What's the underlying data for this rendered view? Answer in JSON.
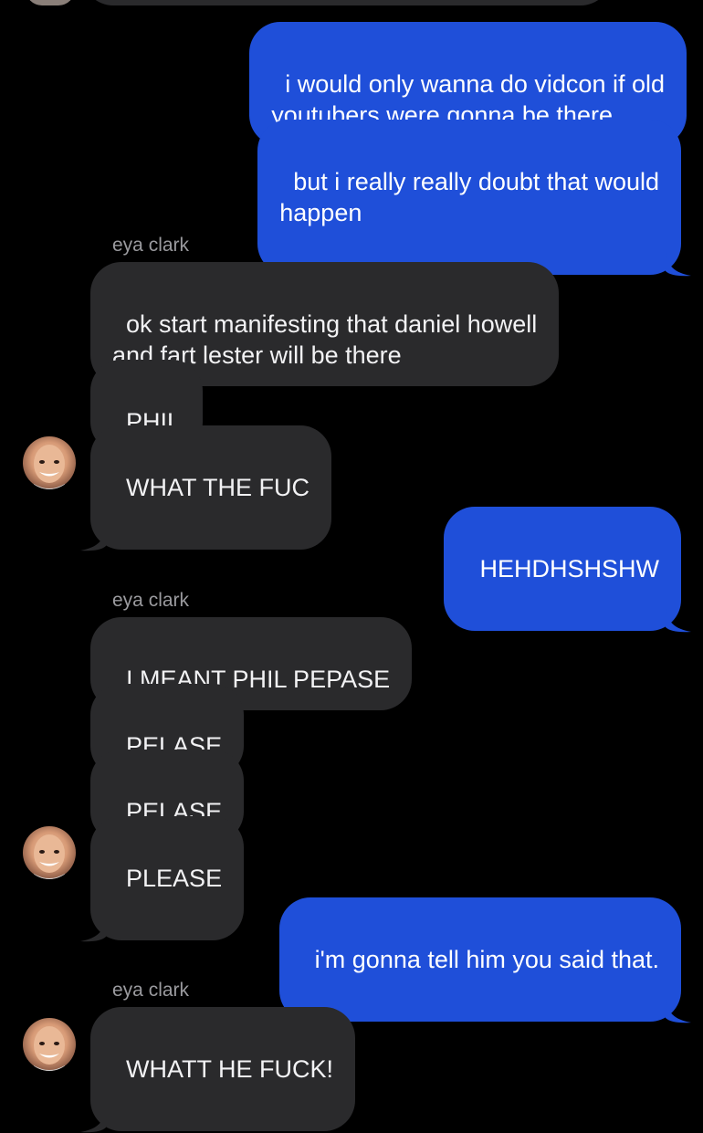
{
  "conversation": {
    "messages": [
      {
        "id": "m1",
        "direction": "out",
        "text": "i would only wanna do vidcon if old\nyoutubers were gonna be there"
      },
      {
        "id": "m2",
        "direction": "out",
        "text": "but i really really doubt that would\nhappen"
      },
      {
        "id": "s1",
        "type": "sender",
        "text": "eya clark"
      },
      {
        "id": "m3",
        "direction": "in",
        "text": "ok start manifesting that daniel howell\nand fart lester will be there"
      },
      {
        "id": "m4",
        "direction": "in",
        "text": "PHIL"
      },
      {
        "id": "m5",
        "direction": "in",
        "text": "WHAT THE FUC"
      },
      {
        "id": "m6",
        "direction": "out",
        "text": "HEHDHSHSHW"
      },
      {
        "id": "s2",
        "type": "sender",
        "text": "eya clark"
      },
      {
        "id": "m7",
        "direction": "in",
        "text": "I MEANT PHIL PEPASE"
      },
      {
        "id": "m8",
        "direction": "in",
        "text": "PELASE"
      },
      {
        "id": "m9",
        "direction": "in",
        "text": "PELASE"
      },
      {
        "id": "m10",
        "direction": "in",
        "text": "PLEASE"
      },
      {
        "id": "m11",
        "direction": "out",
        "text": "i'm gonna tell him you said that."
      },
      {
        "id": "s3",
        "type": "sender",
        "text": "eya clark"
      },
      {
        "id": "m12",
        "direction": "in",
        "text": "WHATT HE FUCK!"
      }
    ]
  },
  "colors": {
    "background": "#000000",
    "outgoing_bubble": "#1f4fd9",
    "incoming_bubble": "#2a2a2c",
    "sender_name": "#9a9a9e"
  },
  "icons": {
    "avatar": "contact-avatar-photo"
  }
}
